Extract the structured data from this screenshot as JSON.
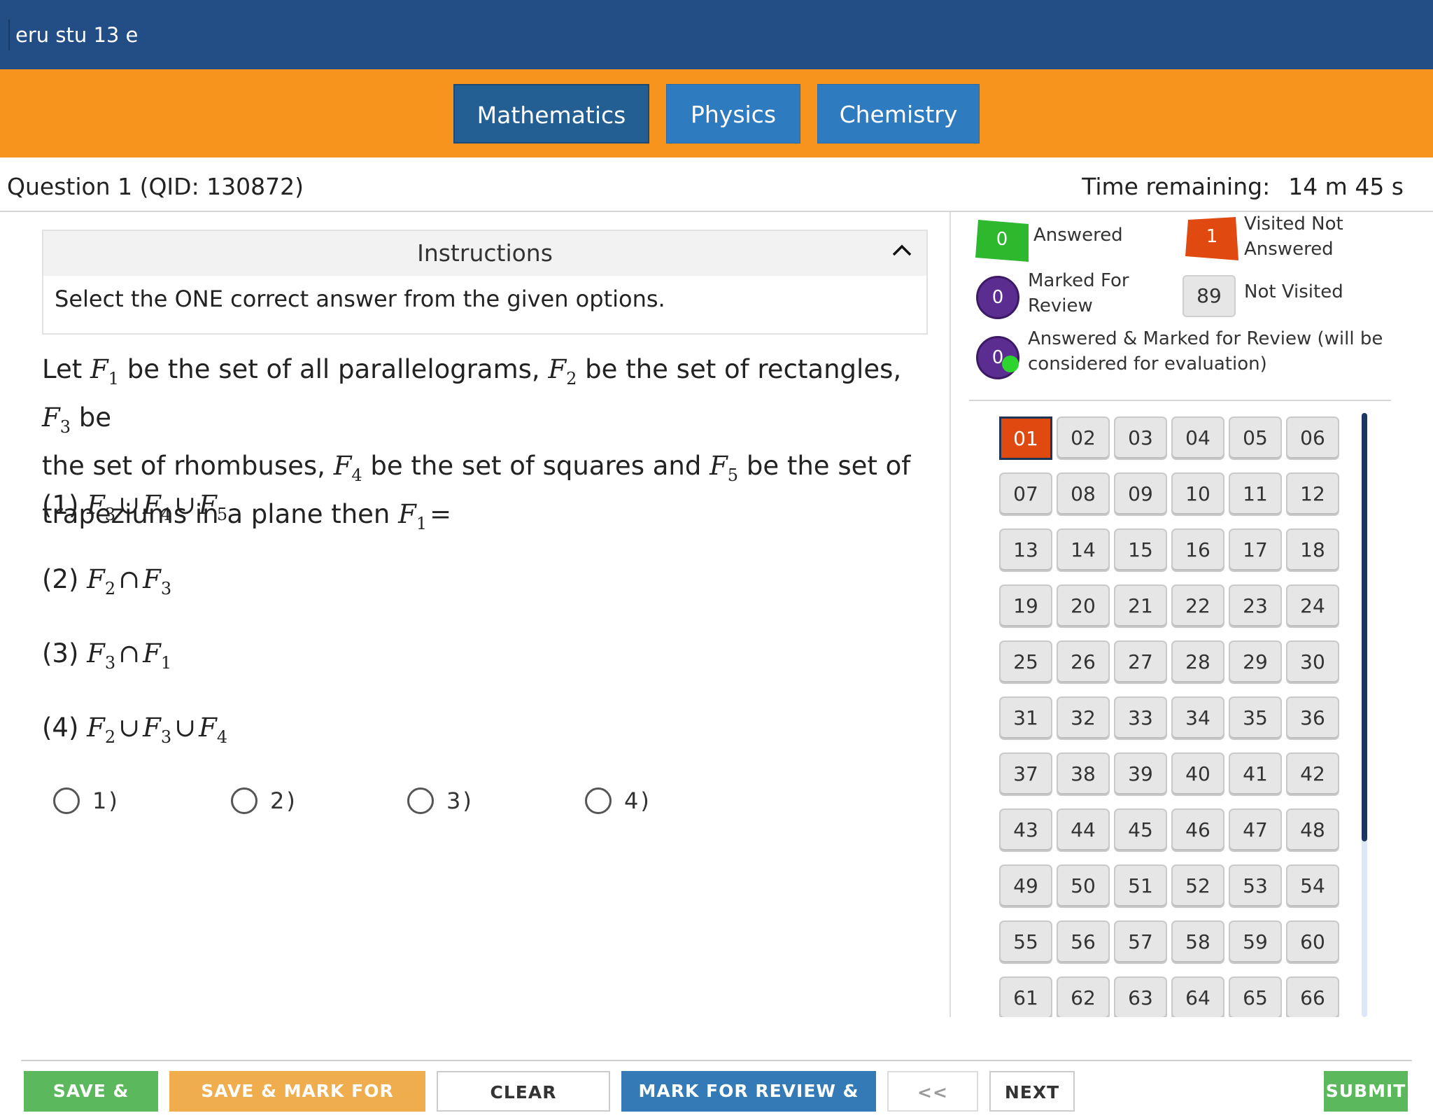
{
  "header": {
    "title": "eru stu 13 e"
  },
  "subjects": [
    {
      "label": "Mathematics",
      "active": true
    },
    {
      "label": "Physics",
      "active": false
    },
    {
      "label": "Chemistry",
      "active": false
    }
  ],
  "question_info": {
    "title": "Question 1 (QID: 130872)",
    "time_label": "Time remaining:",
    "time_value": "14 m 45 s"
  },
  "instructions": {
    "heading": "Instructions",
    "text": "Select the ONE correct answer from the given options."
  },
  "question": {
    "line1_a": "Let ",
    "line1_b": " be the set of all parallelograms, ",
    "line1_c": " be the set of rectangles, ",
    "line1_d": " be",
    "line2_a": "the set of rhombuses, ",
    "line2_b": " be the set of squares and ",
    "line2_c": " be the set of",
    "line3_a": "trapeziums in a plane then ",
    "F": "F",
    "s1": "1",
    "s2": "2",
    "s3": "3",
    "s4": "4",
    "s5": "5",
    "eq": "=",
    "cup": "∪",
    "cap": "∩"
  },
  "options": {
    "o1": "(1) ",
    "o2": "(2) ",
    "o3": "(3) ",
    "o4": "(4) "
  },
  "radios": [
    "1)",
    "2)",
    "3)",
    "4)"
  ],
  "legend": {
    "answered": {
      "count": "0",
      "label": "Answered",
      "color": "#2eb82e"
    },
    "visited_not_answered": {
      "count": "1",
      "label_1": "Visited Not",
      "label_2": "Answered",
      "color": "#e0490f"
    },
    "marked_for_review": {
      "count": "0",
      "label_1": "Marked For",
      "label_2": "Review",
      "color": "#5b2d91"
    },
    "not_visited": {
      "count": "89",
      "label": "Not Visited"
    },
    "answered_marked": {
      "count": "0",
      "label_1": "Answered & Marked for Review (will be",
      "label_2": "considered for evaluation)"
    }
  },
  "palette": {
    "current": "01",
    "numbers": [
      "01",
      "02",
      "03",
      "04",
      "05",
      "06",
      "07",
      "08",
      "09",
      "10",
      "11",
      "12",
      "13",
      "14",
      "15",
      "16",
      "17",
      "18",
      "19",
      "20",
      "21",
      "22",
      "23",
      "24",
      "25",
      "26",
      "27",
      "28",
      "29",
      "30",
      "31",
      "32",
      "33",
      "34",
      "35",
      "36",
      "37",
      "38",
      "39",
      "40",
      "41",
      "42",
      "43",
      "44",
      "45",
      "46",
      "47",
      "48",
      "49",
      "50",
      "51",
      "52",
      "53",
      "54",
      "55",
      "56",
      "57",
      "58",
      "59",
      "60",
      "61",
      "62",
      "63",
      "64",
      "65",
      "66"
    ]
  },
  "footer": {
    "save_next": "SAVE & NEXT",
    "save_mark": "SAVE & MARK FOR REVIEW",
    "clear": "CLEAR RESPONSE",
    "mark_next": "MARK FOR REVIEW & NEXT",
    "back": "<< BACK",
    "next": "NEXT >>",
    "submit": "SUBMIT"
  },
  "colors": {
    "header": "#234d85",
    "subject_bar": "#f7941e",
    "tab": "#2f7bbf",
    "green": "#5cb85c",
    "amber": "#f0ad4e",
    "blue": "#337ab7"
  }
}
